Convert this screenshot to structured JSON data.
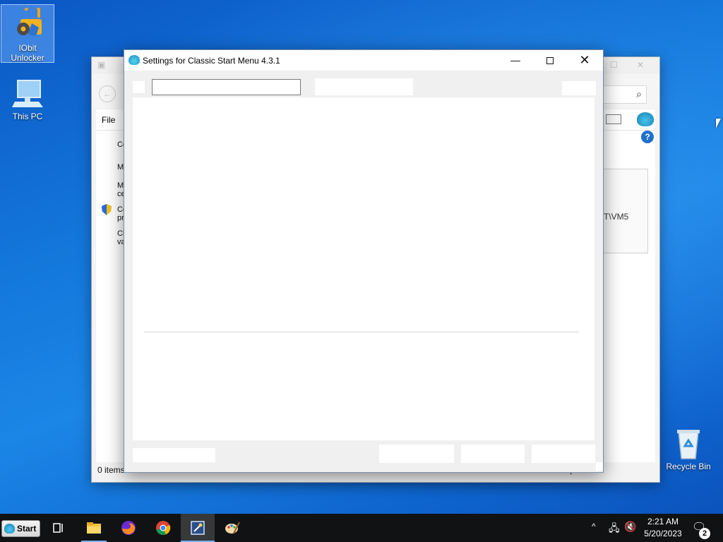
{
  "desktop": {
    "icons": [
      {
        "label": "IObit Unlocker"
      },
      {
        "label": "This PC"
      },
      {
        "label": "Recycle Bin"
      }
    ]
  },
  "background_window": {
    "menu_file": "File",
    "sidebar_fragments": [
      "Co",
      "M",
      "M ce",
      "Co pr",
      "Ch va"
    ],
    "panel_text": "T\\VM5",
    "status_left": "0 items",
    "status_right": "Computer"
  },
  "dialog": {
    "title": "Settings for Classic Start Menu 4.3.1",
    "controls": {
      "minimize": "—",
      "close": "✕"
    },
    "search": {
      "value": "",
      "placeholder": ""
    }
  },
  "taskbar": {
    "start_label": "Start",
    "apps": [
      {
        "icon": "task-view-icon"
      },
      {
        "icon": "file-explorer-icon"
      },
      {
        "icon": "firefox-icon"
      },
      {
        "icon": "chrome-icon"
      },
      {
        "icon": "classic-shell-settings-icon"
      },
      {
        "icon": "paint-icon"
      }
    ],
    "clock": {
      "time": "2:21 AM",
      "date": "5/20/2023"
    },
    "notification_count": "2"
  },
  "colors": {
    "desktop_blue": "#1478db",
    "taskbar": "#101214",
    "accent": "#74b2ff"
  }
}
